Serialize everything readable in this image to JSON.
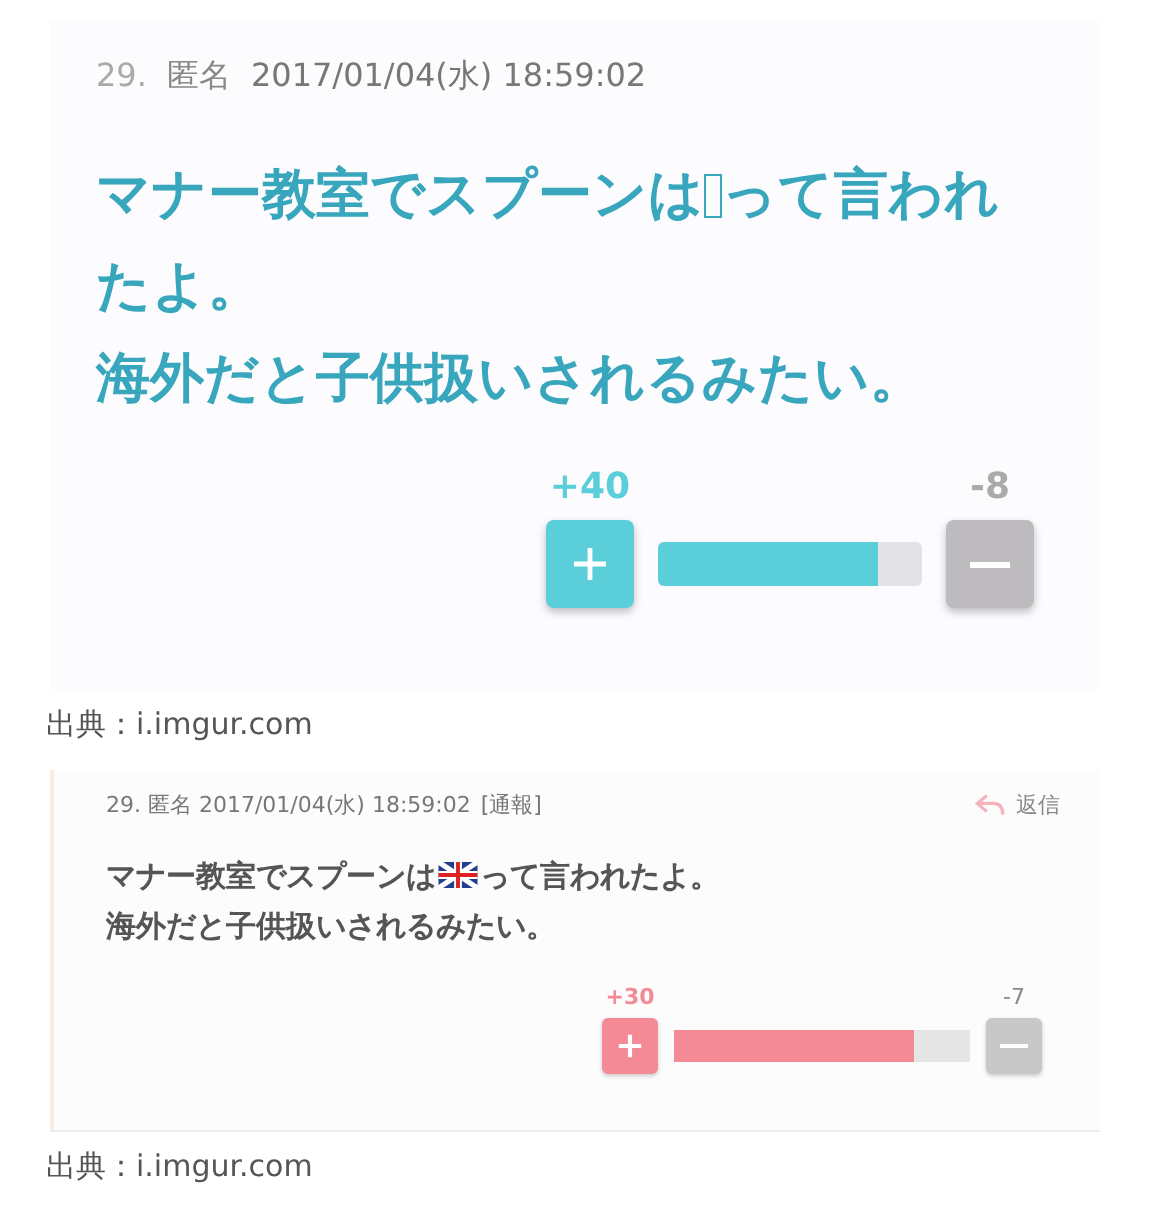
{
  "posts": [
    {
      "kind": "large",
      "number": "29.",
      "name": "匿名",
      "datetime": "2017/01/04(水)  18:59:02",
      "lines": [
        {
          "before": "マナー教室でスプーンは",
          "emoji": {
            "kind": "missing"
          },
          "after": "って言われたよ。"
        },
        {
          "before": "海外だと子供扱いされるみたい。"
        }
      ],
      "votes": {
        "plus": "+40",
        "minus": "-8",
        "level": 0.83
      },
      "source": "出典：i.imgur.com"
    },
    {
      "kind": "embed",
      "header": "29. 匿名 2017/01/04(水) 18:59:02",
      "report": "[通報]",
      "reply": "返信",
      "lines": [
        {
          "before": "マナー教室でスプーンは",
          "emoji": {
            "kind": "flag"
          },
          "after": "って言われたよ。"
        },
        {
          "before": "海外だと子供扱いされるみたい。"
        }
      ],
      "votes": {
        "plus": "+30",
        "minus": "-7",
        "level": 0.81
      },
      "source": "出典：i.imgur.com"
    }
  ]
}
